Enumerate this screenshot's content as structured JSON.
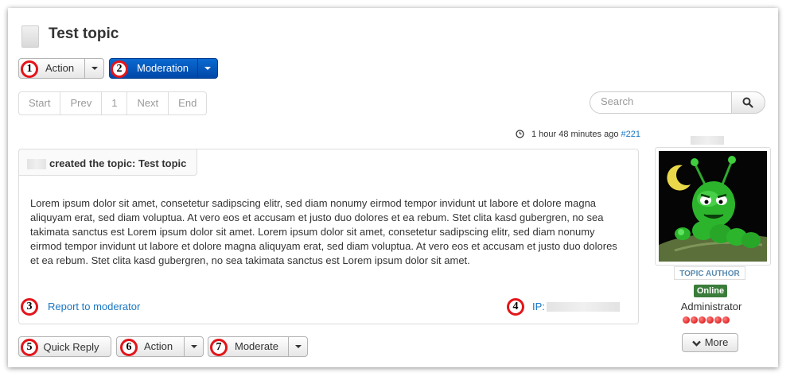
{
  "page": {
    "title": "Test topic"
  },
  "topbar": {
    "action_label": "Action",
    "moderation_label": "Moderation"
  },
  "pagination": [
    "Start",
    "Prev",
    "1",
    "Next",
    "End"
  ],
  "search": {
    "placeholder": "Search"
  },
  "post": {
    "time": "1 hour 48 minutes ago",
    "id_link": "#221",
    "header": "created the topic: Test topic",
    "body": "Lorem ipsum dolor sit amet, consetetur sadipscing elitr, sed diam nonumy eirmod tempor invidunt ut labore et dolore magna aliquyam erat, sed diam voluptua. At vero eos et accusam et justo duo dolores et ea rebum. Stet clita kasd gubergren, no sea takimata sanctus est Lorem ipsum dolor sit amet. Lorem ipsum dolor sit amet, consetetur sadipscing elitr, sed diam nonumy eirmod tempor invidunt ut labore et dolore magna aliquyam erat, sed diam voluptua. At vero eos et accusam et justo duo dolores et ea rebum. Stet clita kasd gubergren, no sea takimata sanctus est Lorem ipsum dolor sit amet.",
    "report_label": "Report to moderator",
    "ip_label": "IP:"
  },
  "bottom_bar": {
    "quick_reply_label": "Quick Reply",
    "action_label": "Action",
    "moderate_label": "Moderate"
  },
  "author": {
    "badge": "TOPIC AUTHOR",
    "status": "Online",
    "rank": "Administrator",
    "more_label": "More"
  },
  "markers": [
    "1",
    "2",
    "3",
    "4",
    "5",
    "6",
    "7"
  ],
  "colors": {
    "primary_blue": "#0055c0",
    "link": "#1976c2",
    "marker_red": "#e3151a",
    "online_green": "#3a7c3a"
  },
  "icons": {
    "page": "document-icon",
    "search": "search-icon",
    "clock": "clock-icon",
    "more": "chevron-down-icon"
  }
}
